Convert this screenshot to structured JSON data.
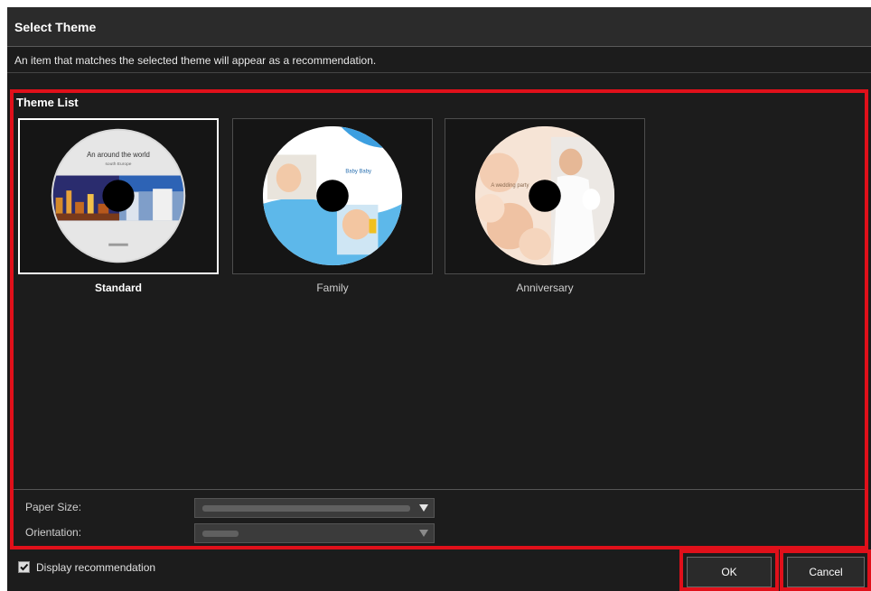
{
  "dialog": {
    "title": "Select Theme",
    "description": "An item that matches the selected theme will appear as a recommendation."
  },
  "theme_list": {
    "label": "Theme List",
    "selected": "Standard",
    "items": [
      {
        "label": "Standard",
        "disc_text": "An around the world",
        "disc_subtext": "south Europe"
      },
      {
        "label": "Family",
        "disc_text": "Baby Baby"
      },
      {
        "label": "Anniversary",
        "disc_text": "A wedding party"
      }
    ]
  },
  "options": {
    "paper_size_label": "Paper Size:",
    "orientation_label": "Orientation:"
  },
  "footer": {
    "display_recommendation_label": "Display recommendation",
    "display_recommendation_checked": true,
    "ok_label": "OK",
    "cancel_label": "Cancel"
  },
  "colors": {
    "dialog_background": "#1c1c1c",
    "highlight_frame": "#e0101a",
    "selection_border": "#ffffff"
  }
}
